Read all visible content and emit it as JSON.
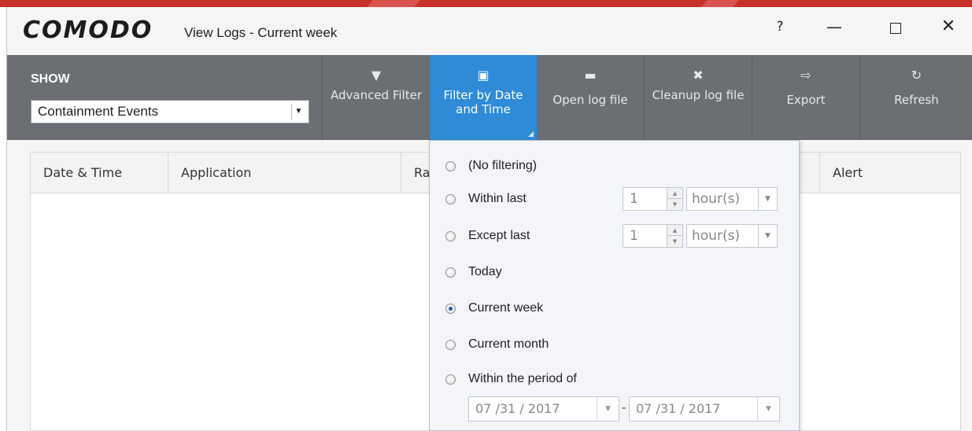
{
  "window": {
    "logo": "COMODO",
    "title": "View Logs - Current week",
    "help_label": "?",
    "minimize_label": "—",
    "close_label": "✕"
  },
  "toolbar": {
    "show_label": "SHOW",
    "show_value": "Containment Events",
    "buttons": [
      {
        "label": "Advanced Filter",
        "icon": "funnel-icon",
        "glyph": "▼"
      },
      {
        "label": "Filter by Date and Time",
        "icon": "calendar-icon",
        "glyph": "▣",
        "active": true
      },
      {
        "label": "Open log file",
        "icon": "folder-icon",
        "glyph": "▬"
      },
      {
        "label": "Cleanup log file",
        "icon": "x-icon",
        "glyph": "✖"
      },
      {
        "label": "Export",
        "icon": "export-icon",
        "glyph": "⇨"
      },
      {
        "label": "Refresh",
        "icon": "refresh-icon",
        "glyph": "↻"
      }
    ]
  },
  "table": {
    "columns": [
      "Date & Time",
      "Application",
      "Ra",
      "Alert"
    ]
  },
  "filter_panel": {
    "options": [
      {
        "label": "(No filtering)",
        "selected": false
      },
      {
        "label": "Within last",
        "selected": false
      },
      {
        "label": "Except last",
        "selected": false
      },
      {
        "label": "Today",
        "selected": false
      },
      {
        "label": "Current week",
        "selected": true
      },
      {
        "label": "Current month",
        "selected": false
      },
      {
        "label": "Within the period of",
        "selected": false
      }
    ],
    "within_last": {
      "value": "1",
      "unit": "hour(s)"
    },
    "except_last": {
      "value": "1",
      "unit": "hour(s)"
    },
    "period": {
      "from": "07 /31 / 2017",
      "to": "07 /31 / 2017",
      "separator": "-"
    }
  },
  "colors": {
    "toolbar": "#6b6e73",
    "active_button": "#2e8bd8",
    "brand_red": "#c9302c"
  }
}
